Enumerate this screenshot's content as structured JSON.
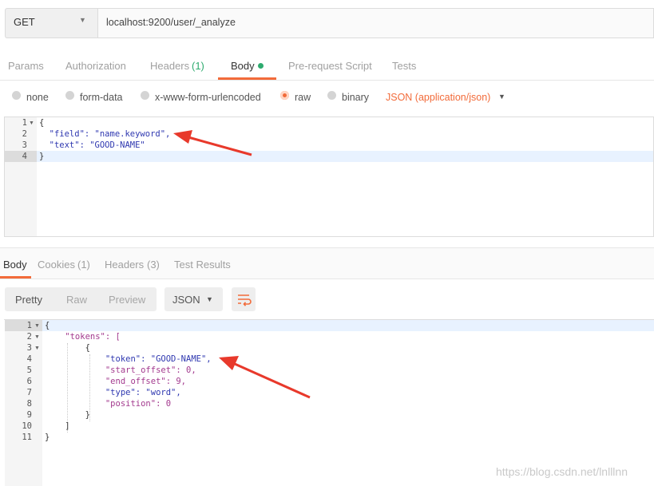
{
  "request": {
    "method": "GET",
    "url": "localhost:9200/user/_analyze",
    "tabs": [
      {
        "label": "Params"
      },
      {
        "label": "Authorization"
      },
      {
        "label": "Headers",
        "count": "(1)"
      },
      {
        "label": "Body"
      },
      {
        "label": "Pre-request Script"
      },
      {
        "label": "Tests"
      }
    ],
    "body_types": [
      "none",
      "form-data",
      "x-www-form-urlencoded",
      "raw",
      "binary"
    ],
    "selected_body_type": "raw",
    "content_type": "JSON (application/json)",
    "editor_lines": [
      {
        "num": "1",
        "text": "{"
      },
      {
        "num": "2",
        "text": "  \"field\": \"name.keyword\","
      },
      {
        "num": "3",
        "text": "  \"text\": \"GOOD-NAME\""
      },
      {
        "num": "4",
        "text": "}"
      }
    ]
  },
  "response": {
    "tabs": [
      {
        "label": "Body"
      },
      {
        "label": "Cookies",
        "count": "(1)"
      },
      {
        "label": "Headers",
        "count": "(3)"
      },
      {
        "label": "Test Results"
      }
    ],
    "view_modes": [
      "Pretty",
      "Raw",
      "Preview"
    ],
    "format": "JSON",
    "lines": [
      {
        "num": "1",
        "text": "{"
      },
      {
        "num": "2",
        "text": "    \"tokens\": ["
      },
      {
        "num": "3",
        "text": "        {"
      },
      {
        "num": "4",
        "text": "            \"token\": \"GOOD-NAME\","
      },
      {
        "num": "5",
        "text": "            \"start_offset\": 0,"
      },
      {
        "num": "6",
        "text": "            \"end_offset\": 9,"
      },
      {
        "num": "7",
        "text": "            \"type\": \"word\","
      },
      {
        "num": "8",
        "text": "            \"position\": 0"
      },
      {
        "num": "9",
        "text": "        }"
      },
      {
        "num": "10",
        "text": "    ]"
      },
      {
        "num": "11",
        "text": "}"
      }
    ]
  },
  "watermark": "https://blog.csdn.net/lnlllnn",
  "colors": {
    "accent": "#f26b3a",
    "count_green": "#2eab6f",
    "annotation_arrow": "#e8392b"
  }
}
